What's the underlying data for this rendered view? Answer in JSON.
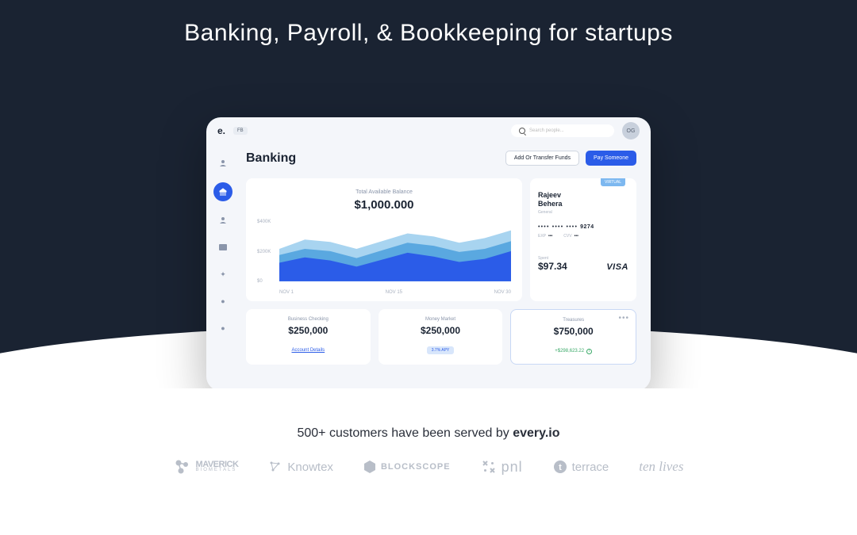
{
  "hero": {
    "headline": "Banking, Payroll, & Bookkeeping for startups"
  },
  "topbar": {
    "logo": "e.",
    "badge": "FB",
    "search_placeholder": "Search people...",
    "avatar_initials": "OG"
  },
  "page": {
    "title": "Banking",
    "btn_transfer": "Add Or Transfer Funds",
    "btn_pay": "Pay Someone"
  },
  "balance": {
    "label": "Total Available Balance",
    "value": "$1,000.000"
  },
  "chart_data": {
    "type": "area",
    "x": [
      "NOV 1",
      "NOV 15",
      "NOV 30"
    ],
    "y_ticks": [
      "$400K",
      "$200K",
      "$0"
    ],
    "ylim": [
      0,
      400
    ],
    "series": [
      {
        "name": "light",
        "color": "#a8d4f0",
        "values": [
          210,
          270,
          255,
          210,
          260,
          310,
          290,
          250,
          280,
          330
        ]
      },
      {
        "name": "mid",
        "color": "#5aa8e0",
        "values": [
          170,
          210,
          195,
          150,
          200,
          250,
          230,
          190,
          210,
          260
        ]
      },
      {
        "name": "dark",
        "color": "#2b5ce8",
        "values": [
          120,
          155,
          135,
          95,
          140,
          185,
          160,
          125,
          145,
          195
        ]
      }
    ]
  },
  "card": {
    "badge": "VIRTUAL",
    "name_first": "Rajeev",
    "name_last": "Behera",
    "subtext": "General",
    "last4": "9274",
    "exp_label": "EXP",
    "exp_val": "•••",
    "cvv_label": "CVV",
    "cvv_val": "•••",
    "spent_label": "Spent",
    "spent_value": "$97.34",
    "network": "VISA"
  },
  "accounts": [
    {
      "title": "Business Checking",
      "balance": "$250,000",
      "extra_type": "link",
      "extra": "Account Details"
    },
    {
      "title": "Money Market",
      "balance": "$250,000",
      "extra_type": "pill",
      "extra": "3.7% APY"
    },
    {
      "title": "Treasures",
      "balance": "$750,000",
      "extra_type": "gain",
      "extra": "+$298,623.22"
    }
  ],
  "footer": {
    "subhead_pre": "500+ customers have been served by ",
    "subhead_bold": "every.io",
    "logos": {
      "maverick": "MAVERICK",
      "maverick_sub": "BIOMETALS",
      "knowtex": "Knowtex",
      "blockscope": "BLOCKSCOPE",
      "pnl": "pnl",
      "terrace": "terrace",
      "tenlives": "ten lives"
    }
  }
}
